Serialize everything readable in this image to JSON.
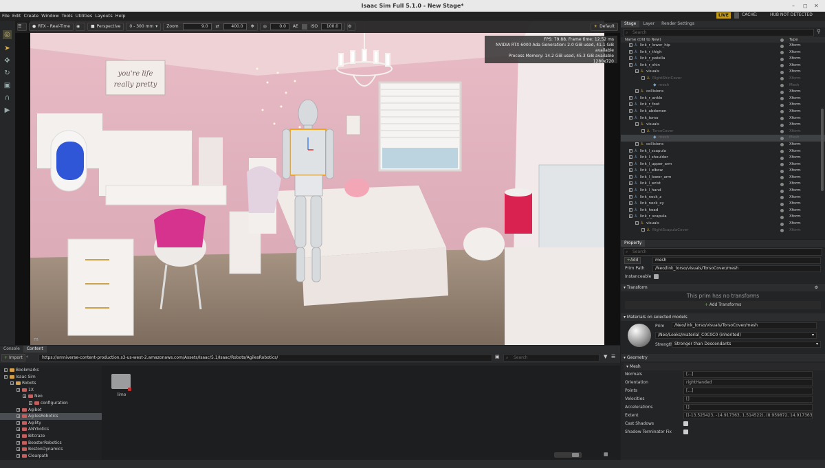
{
  "window": {
    "title": "Isaac Sim Full 5.1.0 - New Stage*",
    "minimize": "–",
    "maximize": "◻",
    "close": "✕"
  },
  "menu": [
    "File",
    "Edit",
    "Create",
    "Window",
    "Tools",
    "Utilities",
    "Layouts",
    "Help"
  ],
  "status": {
    "live": "LIVE",
    "cache": "CACHE:",
    "hub": "HUB NOT DETECTED"
  },
  "viewport": {
    "render_mode": "RTX - Real-Time",
    "camera": "Perspective",
    "focal_range": "0 - 300 mm",
    "zoom_label": "Zoom",
    "zoom_value": "9.0",
    "speed_value": "400.0",
    "exposure_value": "0.0",
    "ae_label": "AE",
    "iso_label": "ISO",
    "iso_value": "100.0",
    "lighting": "Default",
    "stats": [
      "FPS: 79.88, Frame time: 12.52 ms",
      "NVIDIA RTX 6000 Ada Generation: 2.0 GiB used, 41.1 GiB available",
      "Process Memory: 14.2 GiB used, 45.3 GiB available",
      "1280x720"
    ],
    "wall_sign": [
      "you're life",
      "really pretty"
    ],
    "unit": "m"
  },
  "stage": {
    "tabs": [
      "Stage",
      "Layer",
      "Render Settings"
    ],
    "search_placeholder": "Search",
    "col_name": "Name (Old to New)",
    "col_type": "Type",
    "rows": [
      {
        "name": "link_r_lower_hip",
        "type": "Xform",
        "indent": 0
      },
      {
        "name": "link_r_thigh",
        "type": "Xform",
        "indent": 0
      },
      {
        "name": "link_r_patella",
        "type": "Xform",
        "indent": 0
      },
      {
        "name": "link_r_shin",
        "type": "Xform",
        "indent": 0
      },
      {
        "name": "visuals",
        "type": "Xform",
        "indent": 1
      },
      {
        "name": "RightShinCover",
        "type": "Xform",
        "indent": 2,
        "dim": true
      },
      {
        "name": "mesh",
        "type": "Mesh",
        "indent": 3,
        "dim": true
      },
      {
        "name": "collisions",
        "type": "Xform",
        "indent": 1
      },
      {
        "name": "link_r_ankle",
        "type": "Xform",
        "indent": 0
      },
      {
        "name": "link_r_foot",
        "type": "Xform",
        "indent": 0
      },
      {
        "name": "link_abdomen",
        "type": "Xform",
        "indent": 0
      },
      {
        "name": "link_torso",
        "type": "Xform",
        "indent": 0
      },
      {
        "name": "visuals",
        "type": "Xform",
        "indent": 1
      },
      {
        "name": "TorsoCover",
        "type": "Xform",
        "indent": 2,
        "dim": true
      },
      {
        "name": "mesh",
        "type": "Mesh",
        "indent": 3,
        "dim": true,
        "sel": true
      },
      {
        "name": "collisions",
        "type": "Xform",
        "indent": 1
      },
      {
        "name": "link_l_scapula",
        "type": "Xform",
        "indent": 0
      },
      {
        "name": "link_l_shoulder",
        "type": "Xform",
        "indent": 0
      },
      {
        "name": "link_l_upper_arm",
        "type": "Xform",
        "indent": 0
      },
      {
        "name": "link_l_elbow",
        "type": "Xform",
        "indent": 0
      },
      {
        "name": "link_l_lower_arm",
        "type": "Xform",
        "indent": 0
      },
      {
        "name": "link_l_wrist",
        "type": "Xform",
        "indent": 0
      },
      {
        "name": "link_l_hand",
        "type": "Xform",
        "indent": 0
      },
      {
        "name": "link_neck_z",
        "type": "Xform",
        "indent": 0
      },
      {
        "name": "link_neck_xy",
        "type": "Xform",
        "indent": 0
      },
      {
        "name": "link_head",
        "type": "Xform",
        "indent": 0
      },
      {
        "name": "link_r_scapula",
        "type": "Xform",
        "indent": 0
      },
      {
        "name": "visuals",
        "type": "Xform",
        "indent": 1
      },
      {
        "name": "RightScapulaCover",
        "type": "Xform",
        "indent": 2,
        "dim": true
      }
    ]
  },
  "property": {
    "tab": "Property",
    "search_placeholder": "Search",
    "add_label": "Add",
    "prim_name": "mesh",
    "prim_path_label": "Prim Path",
    "prim_path": "/Neo/link_torso/visuals/TorsoCover/mesh",
    "instanceable_label": "Instanceable",
    "transform_title": "Transform",
    "no_transform": "This prim has no transforms",
    "add_transforms": "Add Transforms",
    "materials_title": "Materials on selected models",
    "prim_label": "Prim",
    "material_prim": "/Neo/link_torso/visuals/TorsoCover/mesh",
    "material": "/Neo/Looks/material_C0C0C0 (inherited)",
    "strength_label": "Strength",
    "strength": "Stronger than Descendants",
    "geometry_title": "Geometry",
    "mesh_title": "Mesh",
    "geo_rows": [
      {
        "label": "Normals",
        "value": "[...]"
      },
      {
        "label": "Orientation",
        "value": "rightHanded"
      },
      {
        "label": "Points",
        "value": "[...]"
      },
      {
        "label": "Velocities",
        "value": "[]"
      },
      {
        "label": "Accelerations",
        "value": "[]"
      },
      {
        "label": "Extent",
        "value": "[(-13.525423, -14.917363, 1.514522), (8.959872, 14.917363, 37.419"
      }
    ],
    "cast_shadows": "Cast Shadows",
    "shadow_fix": "Shadow Terminator Fix"
  },
  "content": {
    "tabs": [
      "Console",
      "Content"
    ],
    "import": "Import",
    "url": "https://omniverse-content-production.s3-us-west-2.amazonaws.com/Assets/Isaac/5.1/Isaac/Robots/AgilesRobotics/",
    "search_placeholder": "Search",
    "tree": [
      {
        "name": "Bookmarks",
        "indent": 0
      },
      {
        "name": "Isaac Sim",
        "indent": 0
      },
      {
        "name": "Robots",
        "indent": 1
      },
      {
        "name": "1X",
        "indent": 2
      },
      {
        "name": "Neo",
        "indent": 3
      },
      {
        "name": "configuration",
        "indent": 4
      },
      {
        "name": "Agibot",
        "indent": 2
      },
      {
        "name": "AgilesRobotics",
        "indent": 2,
        "sel": true
      },
      {
        "name": "Agility",
        "indent": 2
      },
      {
        "name": "ANYbotics",
        "indent": 2
      },
      {
        "name": "Bitcraze",
        "indent": 2
      },
      {
        "name": "BoosterRobotics",
        "indent": 2
      },
      {
        "name": "BostonDynamics",
        "indent": 2
      },
      {
        "name": "Clearpath",
        "indent": 2
      }
    ],
    "grid_item": "limo"
  }
}
